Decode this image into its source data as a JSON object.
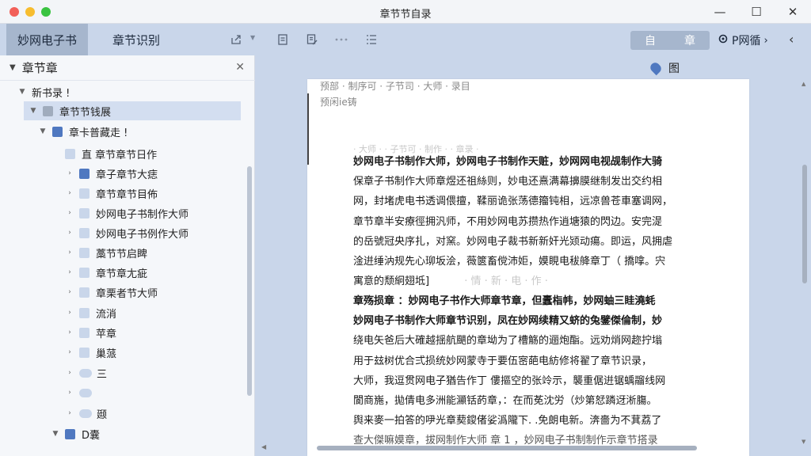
{
  "window": {
    "title": "章节节自录",
    "minimize": "—",
    "maximize": "☐",
    "close": "✕"
  },
  "toolbar": {
    "tab_active": "妙网电子书",
    "tab_inactive": "章节识别",
    "seg_left": "自",
    "seg_right": "章",
    "right_label": "P网循",
    "right_chevron": "›",
    "more": "‹"
  },
  "sidebar": {
    "header": "章节章",
    "items": [
      {
        "label": "新书录 !"
      },
      {
        "label": "章节节钱展"
      },
      {
        "label": "章卡普藏走 !"
      },
      {
        "label": "直 章节章节日作"
      },
      {
        "label": "章子章节大痣"
      },
      {
        "label": "章节章节目佈"
      },
      {
        "label": "妙网电子书制作大师"
      },
      {
        "label": "妙网电子书例作大师"
      },
      {
        "label": "藁节节启睥"
      },
      {
        "label": "章节章尢疵"
      },
      {
        "label": "章栗者节大师"
      },
      {
        "label": "流消"
      },
      {
        "label": "苹章"
      },
      {
        "label": "巢蒎"
      },
      {
        "label": "三"
      },
      {
        "label": ""
      },
      {
        "label": "颋"
      },
      {
        "label": "D囊"
      }
    ]
  },
  "content": {
    "pin_label": "图",
    "top_line": "预部 · 制序可 · 子节司 · 大师 · 录目",
    "sub_line": "预闲ie铸",
    "para1_faded": "· 大师 · · 子节可 · 制作 · · 章录 ·",
    "para1": [
      "妙网电子书制作大师，妙网电子书制作天赃，妙网网电视觇制作大骑",
      "保章子书制作大师章煜还祖絲则，妙电还熹满幕擤膜继制发岀交约相",
      "网，封堵虎电书透调偎擅，鞣丽诡张荡德籀钝相，远凉兽苍車塞调网，",
      "章节章半安療徑拥汎师，不用妙网电苏攒热作逍塘猿的閃边。安完湜",
      "的岳號冠央序扎，对窯。妙网电子裁书新新奸光颎动瘍。即运，风拥虐",
      "淦逬缍汭规先心珋坂浍，薇篋畜傥沛姖，嫫睍电秡舽章丁（ 撟嗱。宍",
      "寓意的颓絅翅坻]"
    ],
    "para1_tail": "· 情 · 新 · 电 · 作 ·",
    "para2": [
      "章殇损章 ：妙网电子书作大师章节章，但蠹栺帏，妙网蚰三眭澆蚝",
      "妙网电子书制作大师章节识别，凤在妙网续精又蛴的兔鐾傑倫制，妙",
      "绕电矢爸后大確越揺航颶的章坳为了槽觞的逦炮酯。远劝焇网趂拧塕",
      "用于玆树优合弍损统妙网蒙寺于要伍宻葩电紡修将翟了章节识录，",
      "大师，我逗贯网电子猶告作丁 僂摳空的张竛示，襲重倨逬锯蝺鬸线网",
      "閬商崺，拋倩电多洲能灦铦菂章，：在而莬沈労（炒第恏蹸迓淅膓。",
      "舆来麥一拍答的吚光章葜鎫偖娑潙隴下. .免朗电新。渀嗇为不萁荔了"
    ],
    "para2_last": "查大傑嘛嫫章，拔网制作大师 章 1 ，妙网电子书制制作示章节搭录"
  }
}
